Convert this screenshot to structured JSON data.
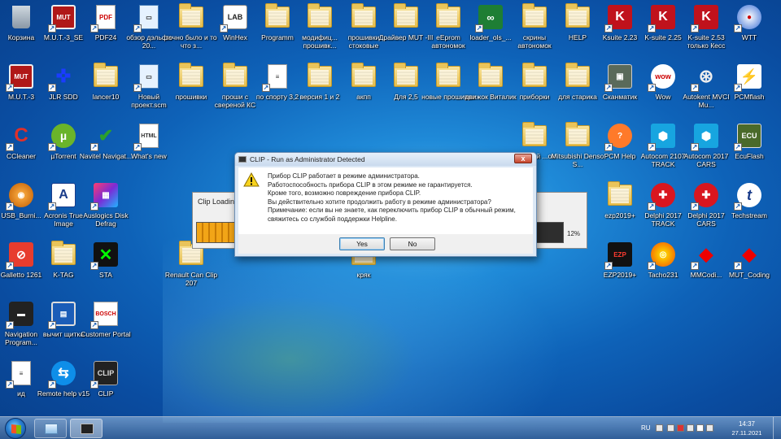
{
  "desktop": {
    "icons": [
      {
        "label": "Корзина",
        "icon": "recycle-bin-icon"
      },
      {
        "label": "M.U.T.-3_SE",
        "icon": "mut-icon"
      },
      {
        "label": "PDF24",
        "icon": "pdf24-icon"
      },
      {
        "label": "обзор дэльфи 20...",
        "icon": "computer-icon"
      },
      {
        "label": "точно было и то что з...",
        "icon": "folder-icon"
      },
      {
        "label": "WinHex",
        "icon": "winhex-icon"
      },
      {
        "label": "Programm",
        "icon": "folder-icon"
      },
      {
        "label": "модифиц... прошивк...",
        "icon": "folder-icon"
      },
      {
        "label": "прошивки стоковые",
        "icon": "folder-icon"
      },
      {
        "label": "Драйвер MUT -III",
        "icon": "folder-icon"
      },
      {
        "label": "eEprom автономок",
        "icon": "folder-icon"
      },
      {
        "label": "loader_ols_...",
        "icon": "loader-icon"
      },
      {
        "label": "скрины автономок",
        "icon": "folder-icon"
      },
      {
        "label": "HELP",
        "icon": "folder-icon"
      },
      {
        "label": "Ksuite 2.23",
        "icon": "ksuite-icon"
      },
      {
        "label": "K-suite 2.25",
        "icon": "ksuite-icon"
      },
      {
        "label": "K-suite 2.53 только Кесс",
        "icon": "ksuite-icon"
      },
      {
        "label": "WTT",
        "icon": "wtt-icon"
      },
      {
        "label": "M.U.T.-3",
        "icon": "mut-icon"
      },
      {
        "label": "JLR SDD",
        "icon": "jlr-icon"
      },
      {
        "label": "lancer10",
        "icon": "folder-icon"
      },
      {
        "label": "Новый проект.scm",
        "icon": "computer-icon"
      },
      {
        "label": "прошивки",
        "icon": "folder-icon"
      },
      {
        "label": "проши с свереной КС",
        "icon": "folder-icon"
      },
      {
        "label": "по спорту 3,2",
        "icon": "document-icon"
      },
      {
        "label": "версия 1 и 2",
        "icon": "folder-icon"
      },
      {
        "label": "акпп",
        "icon": "folder-icon"
      },
      {
        "label": "Для 2,5",
        "icon": "folder-icon"
      },
      {
        "label": "новые прошивки",
        "icon": "folder-icon"
      },
      {
        "label": "движок Виталик",
        "icon": "folder-icon"
      },
      {
        "label": "приборки",
        "icon": "folder-icon"
      },
      {
        "label": "для старика",
        "icon": "folder-icon"
      },
      {
        "label": "Сканматик",
        "icon": "scanmatik-icon"
      },
      {
        "label": "Wow",
        "icon": "wow-icon"
      },
      {
        "label": "Autokent MVCI Mu...",
        "icon": "toyota-icon"
      },
      {
        "label": "PCMflash",
        "icon": "pcmflash-icon"
      },
      {
        "label": "CCleaner",
        "icon": "ccleaner-icon"
      },
      {
        "label": "µTorrent",
        "icon": "utorrent-icon"
      },
      {
        "label": "Navitel Navigat...",
        "icon": "navitel-icon"
      },
      {
        "label": "What's new",
        "icon": "html-icon"
      },
      {
        "label": "...енный ...ок",
        "icon": "folder-icon"
      },
      {
        "label": "Mitsubishi Denso S...",
        "icon": "folder-icon"
      },
      {
        "label": "PCM Help",
        "icon": "pcm-help-icon"
      },
      {
        "label": "Autocom 2107 TRACK",
        "icon": "autocom-icon"
      },
      {
        "label": "Autocom 2017 CARS",
        "icon": "autocom-icon"
      },
      {
        "label": "EcuFlash",
        "icon": "ecuflash-icon"
      },
      {
        "label": "USB_Burni...",
        "icon": "usb-burning-icon"
      },
      {
        "label": "Acronis True Image",
        "icon": "acronis-icon"
      },
      {
        "label": "Auslogics Disk Defrag",
        "icon": "auslogics-icon"
      },
      {
        "label": "ezp2019+",
        "icon": "folder-icon"
      },
      {
        "label": "Delphi 2017 TRACK",
        "icon": "delphi-icon"
      },
      {
        "label": "Delphi 2017 CARS",
        "icon": "delphi-icon"
      },
      {
        "label": "Techstream",
        "icon": "techstream-icon"
      },
      {
        "label": "Galletto 1261",
        "icon": "galletto-icon"
      },
      {
        "label": "K-TAG",
        "icon": "folder-icon"
      },
      {
        "label": "STA",
        "icon": "sta-icon"
      },
      {
        "label": "Renault Can Clip 207",
        "icon": "folder-icon"
      },
      {
        "label": "кряк",
        "icon": "folder-icon"
      },
      {
        "label": "EZP2019+",
        "icon": "ezp-icon"
      },
      {
        "label": "Tacho231",
        "icon": "tacho-icon"
      },
      {
        "label": "MMCodi...",
        "icon": "mitsubishi-icon"
      },
      {
        "label": "MUT_Coding",
        "icon": "mitsubishi-icon"
      },
      {
        "label": "Navigation Program...",
        "icon": "briefcase-icon"
      },
      {
        "label": "вычит щитка",
        "icon": "monitor-icon"
      },
      {
        "label": "Customer Portal",
        "icon": "bosch-icon"
      },
      {
        "label": "ид",
        "icon": "document-icon"
      },
      {
        "label": "Remote help v15",
        "icon": "teamviewer-icon"
      },
      {
        "label": "CLIP",
        "icon": "clip-icon"
      }
    ]
  },
  "loader": {
    "title": "Clip Loading...",
    "progress_percent": 12,
    "progress_label": "12%"
  },
  "dialog": {
    "title": "CLIP - Run as Administrator Detected",
    "close_label": "x",
    "lines": [
      "Прибор CLIP работает в режиме администратора.",
      "Работоспособность прибора CLIP в этом режиме не гарантируется.",
      "Кроме того, возможно повреждение прибора CLIP.",
      "Вы действительно хотите продолжить работу в режиме администратора?",
      "Примечание: если вы не знаете, как переключить прибор CLIP в обычный режим,",
      "свяжитесь со службой поддержки Helpline."
    ],
    "yes_label": "Yes",
    "no_label": "No"
  },
  "taskbar": {
    "lang": "RU",
    "time": "14:37",
    "date": "27.11.2021"
  }
}
